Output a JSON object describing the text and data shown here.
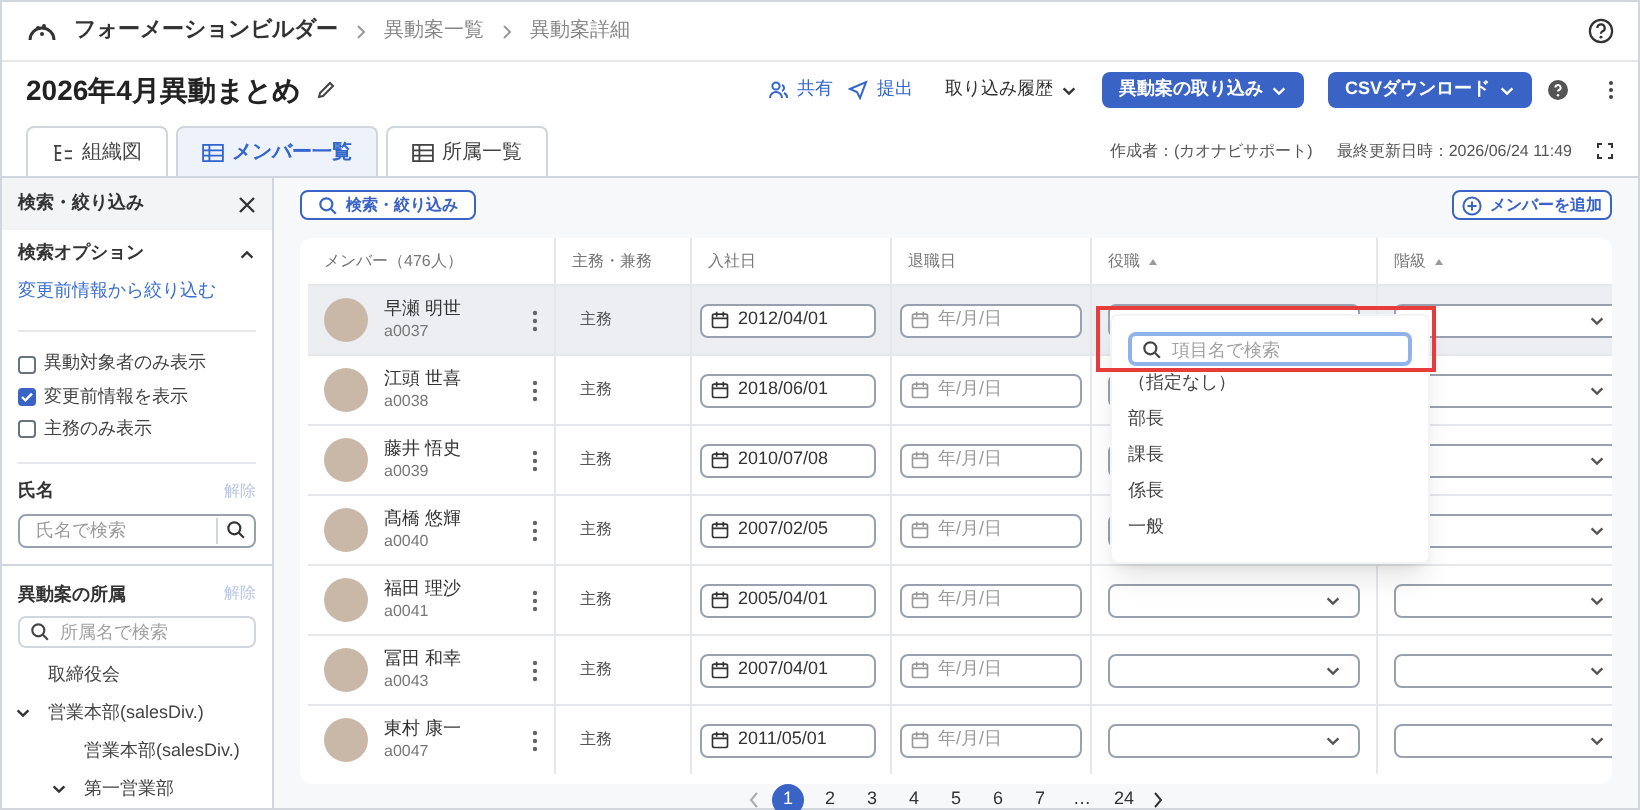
{
  "breadcrumb": [
    "フォーメーションビルダー",
    "異動案一覧",
    "異動案詳細"
  ],
  "title": "2026年4月異動まとめ",
  "actions": {
    "share": "共有",
    "submit": "提出",
    "history": "取り込み履歴",
    "import": "異動案の取り込み",
    "csv": "CSVダウンロード"
  },
  "tabs": [
    {
      "label": "組織図",
      "selected": false,
      "kind": "chart"
    },
    {
      "label": "メンバー一覧",
      "selected": true,
      "kind": "list"
    },
    {
      "label": "所属一覧",
      "selected": false,
      "kind": "list"
    }
  ],
  "meta": {
    "author": "作成者：(カオナビサポート)",
    "updated": "最終更新日時：2026/06/24 11:49"
  },
  "sidebar": {
    "title": "検索・絞り込み",
    "options_title": "検索オプション",
    "options_link": "変更前情報から絞り込む",
    "checkboxes": [
      {
        "label": "異動対象者のみ表示",
        "checked": false
      },
      {
        "label": "変更前情報を表示",
        "checked": true
      },
      {
        "label": "主務のみ表示",
        "checked": false
      }
    ],
    "name_title": "氏名",
    "name_clear": "解除",
    "name_placeholder": "氏名で検索",
    "dept_title": "異動案の所属",
    "dept_clear": "解除",
    "dept_placeholder": "所属名で検索",
    "tree": [
      {
        "label": "取締役会"
      },
      {
        "label": "営業本部(salesDiv.)",
        "expanded": true,
        "children": [
          {
            "label": "営業本部(salesDiv.)"
          },
          {
            "label": "第一営業部",
            "expanded": true
          }
        ]
      }
    ]
  },
  "search_button": "検索・絞り込み",
  "add_button": "メンバーを追加",
  "table": {
    "columns": [
      "メンバー（476人）",
      "主務・兼務",
      "入社日",
      "退職日",
      "役職",
      "階級"
    ],
    "rows": [
      {
        "name": "早瀬 明世",
        "id": "a0037",
        "duty": "主務",
        "joined": "2012/04/01",
        "retired_placeholder": "年/月/日",
        "selected": true
      },
      {
        "name": "江頭 世喜",
        "id": "a0038",
        "duty": "主務",
        "joined": "2018/06/01",
        "retired_placeholder": "年/月/日",
        "selected": false
      },
      {
        "name": "藤井 悟史",
        "id": "a0039",
        "duty": "主務",
        "joined": "2010/07/08",
        "retired_placeholder": "年/月/日",
        "selected": false
      },
      {
        "name": "髙橋 悠輝",
        "id": "a0040",
        "duty": "主務",
        "joined": "2007/02/05",
        "retired_placeholder": "年/月/日",
        "selected": false
      },
      {
        "name": "福田 理沙",
        "id": "a0041",
        "duty": "主務",
        "joined": "2005/04/01",
        "retired_placeholder": "年/月/日",
        "selected": false
      },
      {
        "name": "冨田 和幸",
        "id": "a0043",
        "duty": "主務",
        "joined": "2007/04/01",
        "retired_placeholder": "年/月/日",
        "selected": false
      },
      {
        "name": "東村 康一",
        "id": "a0047",
        "duty": "主務",
        "joined": "2011/05/01",
        "retired_placeholder": "年/月/日",
        "selected": false
      }
    ]
  },
  "dropdown": {
    "placeholder": "項目名で検索",
    "options": [
      "（指定なし）",
      "部長",
      "課長",
      "係長",
      "一般"
    ]
  },
  "pagination": {
    "pages": [
      {
        "label": "1",
        "selected": true
      },
      {
        "label": "2",
        "selected": false
      },
      {
        "label": "3",
        "selected": false
      },
      {
        "label": "4",
        "selected": false
      },
      {
        "label": "5",
        "selected": false
      },
      {
        "label": "6",
        "selected": false
      },
      {
        "label": "7",
        "selected": false
      },
      {
        "label": "…",
        "selected": false
      },
      {
        "label": "24",
        "selected": false
      }
    ]
  }
}
